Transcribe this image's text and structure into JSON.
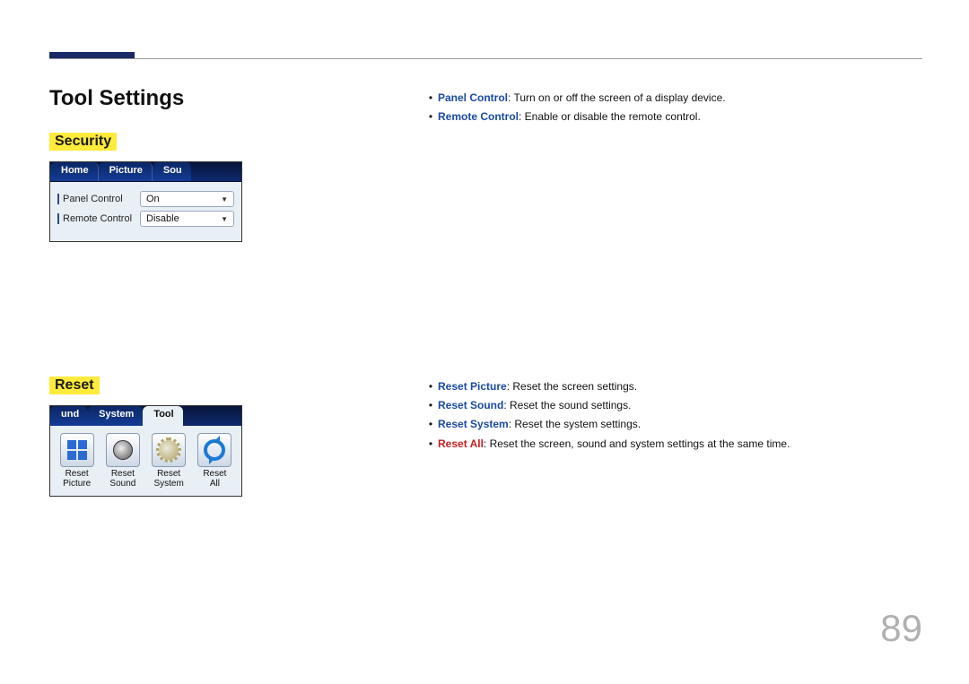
{
  "page": {
    "title": "Tool Settings",
    "number": "89"
  },
  "security": {
    "heading": "Security",
    "tabs": [
      "Home",
      "Picture",
      "Sou"
    ],
    "rows": [
      {
        "label": "Panel Control",
        "value": "On"
      },
      {
        "label": "Remote Control",
        "value": "Disable"
      }
    ],
    "bullets": [
      {
        "label": "Panel Control",
        "desc": ": Turn on or off the screen of a display device."
      },
      {
        "label": "Remote Control",
        "desc": ": Enable or disable the remote control."
      }
    ]
  },
  "reset": {
    "heading": "Reset",
    "tabs": [
      "und",
      "System",
      "Tool"
    ],
    "items": [
      {
        "line1": "Reset",
        "line2": "Picture"
      },
      {
        "line1": "Reset",
        "line2": "Sound"
      },
      {
        "line1": "Reset",
        "line2": "System"
      },
      {
        "line1": "Reset",
        "line2": "All"
      }
    ],
    "bullets": [
      {
        "label": "Reset Picture",
        "desc": ": Reset the screen settings."
      },
      {
        "label": "Reset Sound",
        "desc": ": Reset the sound settings."
      },
      {
        "label": "Reset System",
        "desc": ": Reset the system settings."
      },
      {
        "label": "Reset All",
        "desc": ": Reset the screen, sound and system settings at the same time.",
        "red": true
      }
    ]
  }
}
